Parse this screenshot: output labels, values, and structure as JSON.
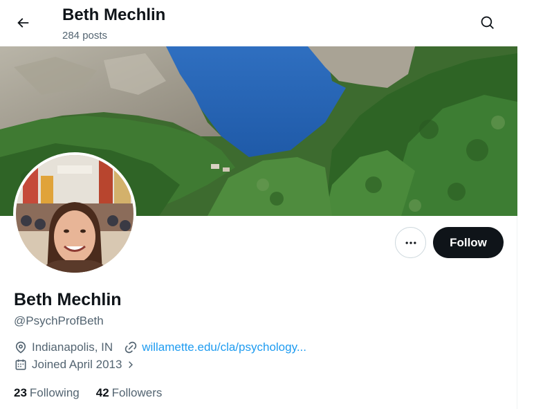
{
  "header": {
    "title": "Beth Mechlin",
    "post_count": "284 posts"
  },
  "profile": {
    "display_name": "Beth Mechlin",
    "handle": "@PsychProfBeth",
    "location": "Indianapolis, IN",
    "website": "willamette.edu/cla/psychology...",
    "joined": "Joined April 2013",
    "following_count": "23",
    "following_label": "Following",
    "followers_count": "42",
    "followers_label": "Followers"
  },
  "actions": {
    "follow_label": "Follow"
  },
  "icons": {
    "back": "arrow-left-icon",
    "search": "search-icon",
    "more": "more-dots-icon",
    "location": "location-pin-icon",
    "link": "link-icon",
    "calendar": "calendar-icon",
    "chevron": "chevron-right-icon"
  },
  "colors": {
    "text_primary": "#0f1419",
    "text_secondary": "#536471",
    "link": "#1d9bf0",
    "follow_bg": "#0f1419",
    "border": "#cfd9de"
  }
}
